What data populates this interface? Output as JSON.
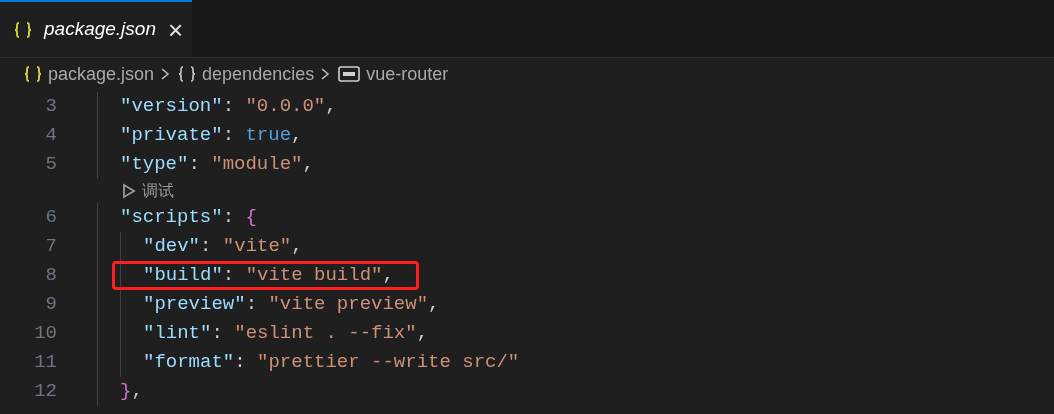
{
  "tabs": [
    {
      "label": "package.json",
      "selected": true,
      "close": "×"
    }
  ],
  "breadcrumbs": [
    {
      "kind": "json",
      "label": "package.json"
    },
    {
      "kind": "object",
      "label": "dependencies"
    },
    {
      "kind": "string",
      "label": "vue-router"
    }
  ],
  "lines": [
    {
      "kind": "code",
      "number": "3",
      "tokens": [
        {
          "kind": "key",
          "text": "\"version\""
        },
        {
          "kind": "punct",
          "text": ": "
        },
        {
          "kind": "string",
          "text": "\"0.0.0\""
        },
        {
          "kind": "punct",
          "text": ","
        }
      ]
    },
    {
      "kind": "code",
      "number": "4",
      "tokens": [
        {
          "kind": "key",
          "text": "\"private\""
        },
        {
          "kind": "punct",
          "text": ": "
        },
        {
          "kind": "bool",
          "text": "true"
        },
        {
          "kind": "punct",
          "text": ","
        }
      ]
    },
    {
      "kind": "code",
      "number": "5",
      "tokens": [
        {
          "kind": "key",
          "text": "\"type\""
        },
        {
          "kind": "punct",
          "text": ": "
        },
        {
          "kind": "string",
          "text": "\"module\""
        },
        {
          "kind": "punct",
          "text": ","
        }
      ]
    },
    {
      "kind": "codelens",
      "label": "调试"
    },
    {
      "kind": "code",
      "number": "6",
      "tokens": [
        {
          "kind": "key",
          "text": "\"scripts\""
        },
        {
          "kind": "punct",
          "text": ": "
        },
        {
          "kind": "brace",
          "text": "{"
        }
      ],
      "children": [
        {
          "kind": "code",
          "number": "7",
          "tokens": [
            {
              "kind": "key",
              "text": "\"dev\""
            },
            {
              "kind": "punct",
              "text": ": "
            },
            {
              "kind": "string",
              "text": "\"vite\""
            },
            {
              "kind": "punct",
              "text": ","
            }
          ]
        },
        {
          "kind": "code",
          "number": "8",
          "highlighted": true,
          "tokens": [
            {
              "kind": "key",
              "text": "\"build\""
            },
            {
              "kind": "punct",
              "text": ": "
            },
            {
              "kind": "string",
              "text": "\"vite build\""
            },
            {
              "kind": "punct",
              "text": ","
            }
          ]
        },
        {
          "kind": "code",
          "number": "9",
          "tokens": [
            {
              "kind": "key",
              "text": "\"preview\""
            },
            {
              "kind": "punct",
              "text": ": "
            },
            {
              "kind": "string",
              "text": "\"vite preview\""
            },
            {
              "kind": "punct",
              "text": ","
            }
          ]
        },
        {
          "kind": "code",
          "number": "10",
          "tokens": [
            {
              "kind": "key",
              "text": "\"lint\""
            },
            {
              "kind": "punct",
              "text": ": "
            },
            {
              "kind": "string",
              "text": "\"eslint . --fix\""
            },
            {
              "kind": "punct",
              "text": ","
            }
          ]
        },
        {
          "kind": "code",
          "number": "11",
          "tokens": [
            {
              "kind": "key",
              "text": "\"format\""
            },
            {
              "kind": "punct",
              "text": ": "
            },
            {
              "kind": "string",
              "text": "\"prettier --write src/\""
            }
          ]
        }
      ]
    },
    {
      "kind": "code",
      "number": "12",
      "tokens": [
        {
          "kind": "brace",
          "text": "}"
        },
        {
          "kind": "punct",
          "text": ","
        }
      ]
    }
  ]
}
